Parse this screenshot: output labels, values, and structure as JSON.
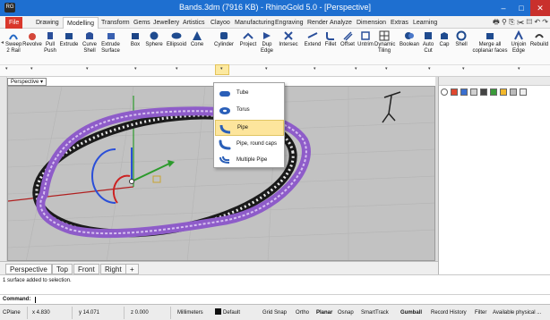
{
  "window": {
    "title": "Bands.3dm (7916 KB) - RhinoGold 5.0 - [Perspective]",
    "app_icon_text": "RG",
    "minimize_glyph": "–",
    "maximize_glyph": "□",
    "close_glyph": "✕"
  },
  "menu_tabs": [
    {
      "label": "File"
    },
    {
      "label": "Drawing"
    },
    {
      "label": "Modelling"
    },
    {
      "label": "Transform"
    },
    {
      "label": "Gems"
    },
    {
      "label": "Jewellery"
    },
    {
      "label": "Artistics"
    },
    {
      "label": "Clayoo"
    },
    {
      "label": "Manufacturing"
    },
    {
      "label": "Engraving"
    },
    {
      "label": "Render"
    },
    {
      "label": "Analyze"
    },
    {
      "label": "Dimension"
    },
    {
      "label": "Extras"
    },
    {
      "label": "Learning"
    }
  ],
  "active_tab": "Modelling",
  "ribbon_tools": [
    {
      "label": "Sweep 2 Rail",
      "icon": "sweep-2-rail-icon"
    },
    {
      "label": "Revolve",
      "icon": "revolve-icon"
    },
    {
      "label": "Pull Push",
      "icon": "pull-push-icon"
    },
    {
      "label": "Extrude",
      "icon": "extrude-icon"
    },
    {
      "label": "Curve Shell",
      "icon": "curve-shell-icon"
    },
    {
      "label": "Extrude Surface",
      "icon": "extrude-surface-icon"
    },
    {
      "label": "Box",
      "icon": "box-icon"
    },
    {
      "label": "Sphere",
      "icon": "sphere-icon"
    },
    {
      "label": "Ellipsoid",
      "icon": "ellipsoid-icon"
    },
    {
      "label": "Cone",
      "icon": "cone-icon"
    },
    {
      "label": "Cylinder",
      "icon": "cylinder-icon"
    },
    {
      "label": "Project",
      "icon": "project-icon"
    },
    {
      "label": "Dup Edge",
      "icon": "dup-edge-icon"
    },
    {
      "label": "Intersec",
      "icon": "intersect-icon"
    },
    {
      "label": "Extend",
      "icon": "extend-icon"
    },
    {
      "label": "Fillet",
      "icon": "fillet-icon"
    },
    {
      "label": "Offset",
      "icon": "offset-icon"
    },
    {
      "label": "Untrim",
      "icon": "untrim-icon"
    },
    {
      "label": "Dynamic Tiling",
      "icon": "dynamic-tiling-icon"
    },
    {
      "label": "Boolean",
      "icon": "boolean-icon"
    },
    {
      "label": "Auto Cut",
      "icon": "auto-cut-icon"
    },
    {
      "label": "Cap",
      "icon": "cap-icon"
    },
    {
      "label": "Shell",
      "icon": "shell-icon"
    },
    {
      "label": "Merge all coplanar faces",
      "icon": "merge-faces-icon"
    },
    {
      "label": "Unjoin Edge",
      "icon": "unjoin-edge-icon"
    },
    {
      "label": "Rebuild",
      "icon": "rebuild-icon"
    }
  ],
  "ribbon_dropdown_glyph": "▾",
  "viewport_label": "Perspective",
  "dropdown_menu": [
    {
      "label": "Tube",
      "icon": "tube-icon"
    },
    {
      "label": "Torus",
      "icon": "torus-icon"
    },
    {
      "label": "Pipe",
      "icon": "pipe-icon"
    },
    {
      "label": "Pipe, round caps",
      "icon": "pipe-round-caps-icon"
    },
    {
      "label": "Multiple Pipe",
      "icon": "multiple-pipe-icon"
    }
  ],
  "highlighted_menu_item": "Pipe",
  "view_tabs": [
    {
      "label": "Perspective"
    },
    {
      "label": "Top"
    },
    {
      "label": "Front"
    },
    {
      "label": "Right"
    },
    {
      "label": "+"
    }
  ],
  "command_history": "1 surface added to selection.",
  "command_label": "Command:",
  "status": {
    "cplane": "CPlane",
    "x": "x 4.830",
    "y": "y 14.071",
    "z": "z 0.000",
    "units": "Millimeters",
    "layer": "Default",
    "grid_snap": "Grid Snap",
    "ortho": "Ortho",
    "planar": "Planar",
    "osnap": "Osnap",
    "smarttrack": "SmartTrack",
    "gumball": "Gumball",
    "record_history": "Record History",
    "filter": "Filter",
    "memory": "Available physical ..."
  },
  "colors": {
    "titlebar": "#1e6fd0",
    "file_tab": "#d9372b",
    "viewport_bg": "#c2c2c2",
    "band_purple": "#8e5cc9",
    "highlight": "#fde59c"
  }
}
